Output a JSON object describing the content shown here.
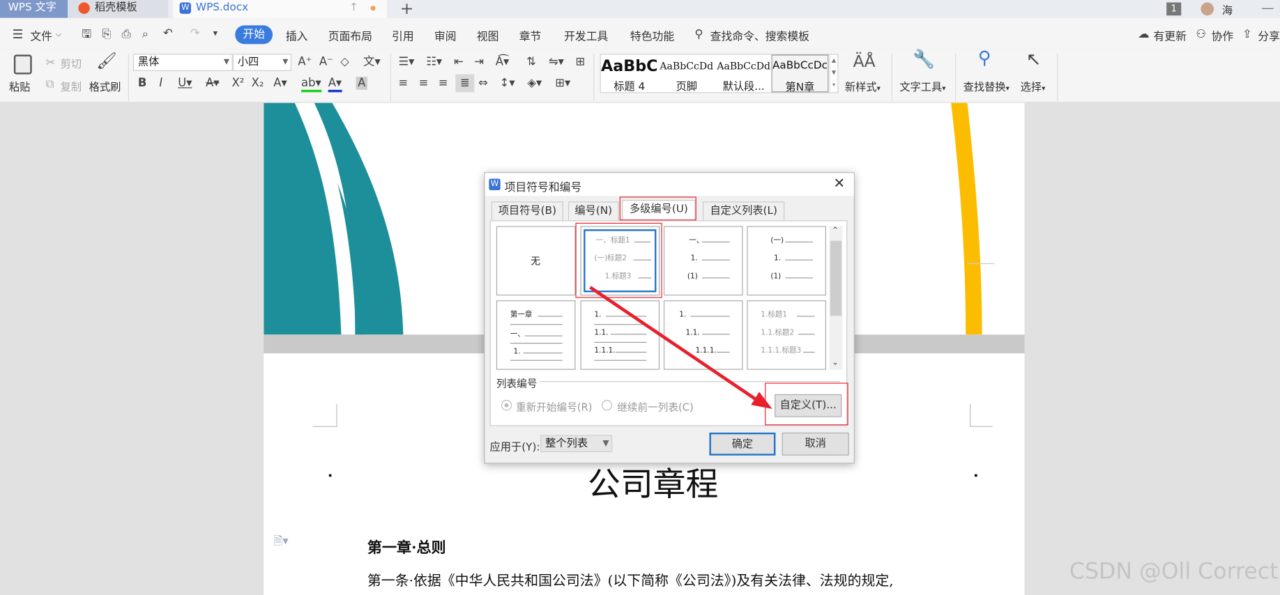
{
  "titlebar": {
    "tabs": [
      {
        "label": "WPS 文字"
      },
      {
        "label": "稻壳模板"
      },
      {
        "label": "WPS.docx"
      }
    ],
    "new_tab": "+",
    "window_count": "1",
    "user_name": "海"
  },
  "menubar": {
    "file": "文件",
    "items": [
      "开始",
      "插入",
      "页面布局",
      "引用",
      "审阅",
      "视图",
      "章节",
      "开发工具",
      "特色功能"
    ],
    "search_placeholder": "查找命令、搜索模板",
    "right": [
      "有更新",
      "协作",
      "分享"
    ]
  },
  "ribbon": {
    "paste": "粘贴",
    "cut": "剪切",
    "copy": "复制",
    "format_painter": "格式刷",
    "font_name": "黑体",
    "font_size": "小四",
    "styles": [
      {
        "preview": "AaBbC",
        "name": "标题 4"
      },
      {
        "preview": "AaBbCcDd",
        "name": "页脚"
      },
      {
        "preview": "AaBbCcDd",
        "name": "默认段..."
      },
      {
        "preview": "AaBbCcDc",
        "name": "第N章"
      }
    ],
    "new_style": "新样式",
    "text_tool": "文字工具",
    "find_replace": "查找替换",
    "select": "选择"
  },
  "document": {
    "title": "公司章程",
    "heading": "第一章·总则",
    "paragraph": "第一条·依据《中华人民共和国公司法》(以下简称《公司法》)及有关法律、法规的规定,",
    "watermark": "CSDN @Oll Correct"
  },
  "dialog": {
    "title": "项目符号和编号",
    "tabs": [
      "项目符号(B)",
      "编号(N)",
      "多级编号(U)",
      "自定义列表(L)"
    ],
    "active_tab": "多级编号(U)",
    "none_label": "无",
    "cells": {
      "c2": [
        "一、标题1",
        "(一)标题2",
        "1.标题3"
      ],
      "c3": [
        "一、",
        "1.",
        "(1)"
      ],
      "c4": [
        "(一)",
        "1.",
        "(1)"
      ],
      "c5": [
        "第一章",
        "一、",
        "1."
      ],
      "c6": [
        "1.",
        "1.1.",
        "1.1.1."
      ],
      "c7": [
        "1.",
        "1.1.",
        "1.1.1."
      ],
      "c8": [
        "1.标题1",
        "1.1.标题2",
        "1.1.1.标题3"
      ]
    },
    "list_numbering": "列表编号",
    "restart": "重新开始编号(R)",
    "continue": "继续前一列表(C)",
    "customize": "自定义(T)...",
    "apply_to_label": "应用于(Y):",
    "apply_to_value": "整个列表",
    "ok": "确定",
    "cancel": "取消"
  },
  "colors": {
    "accent": "#3a7be0",
    "teal": "#1c8f9a",
    "yellow": "#fcbd00",
    "annotation_red": "#e8202c"
  }
}
